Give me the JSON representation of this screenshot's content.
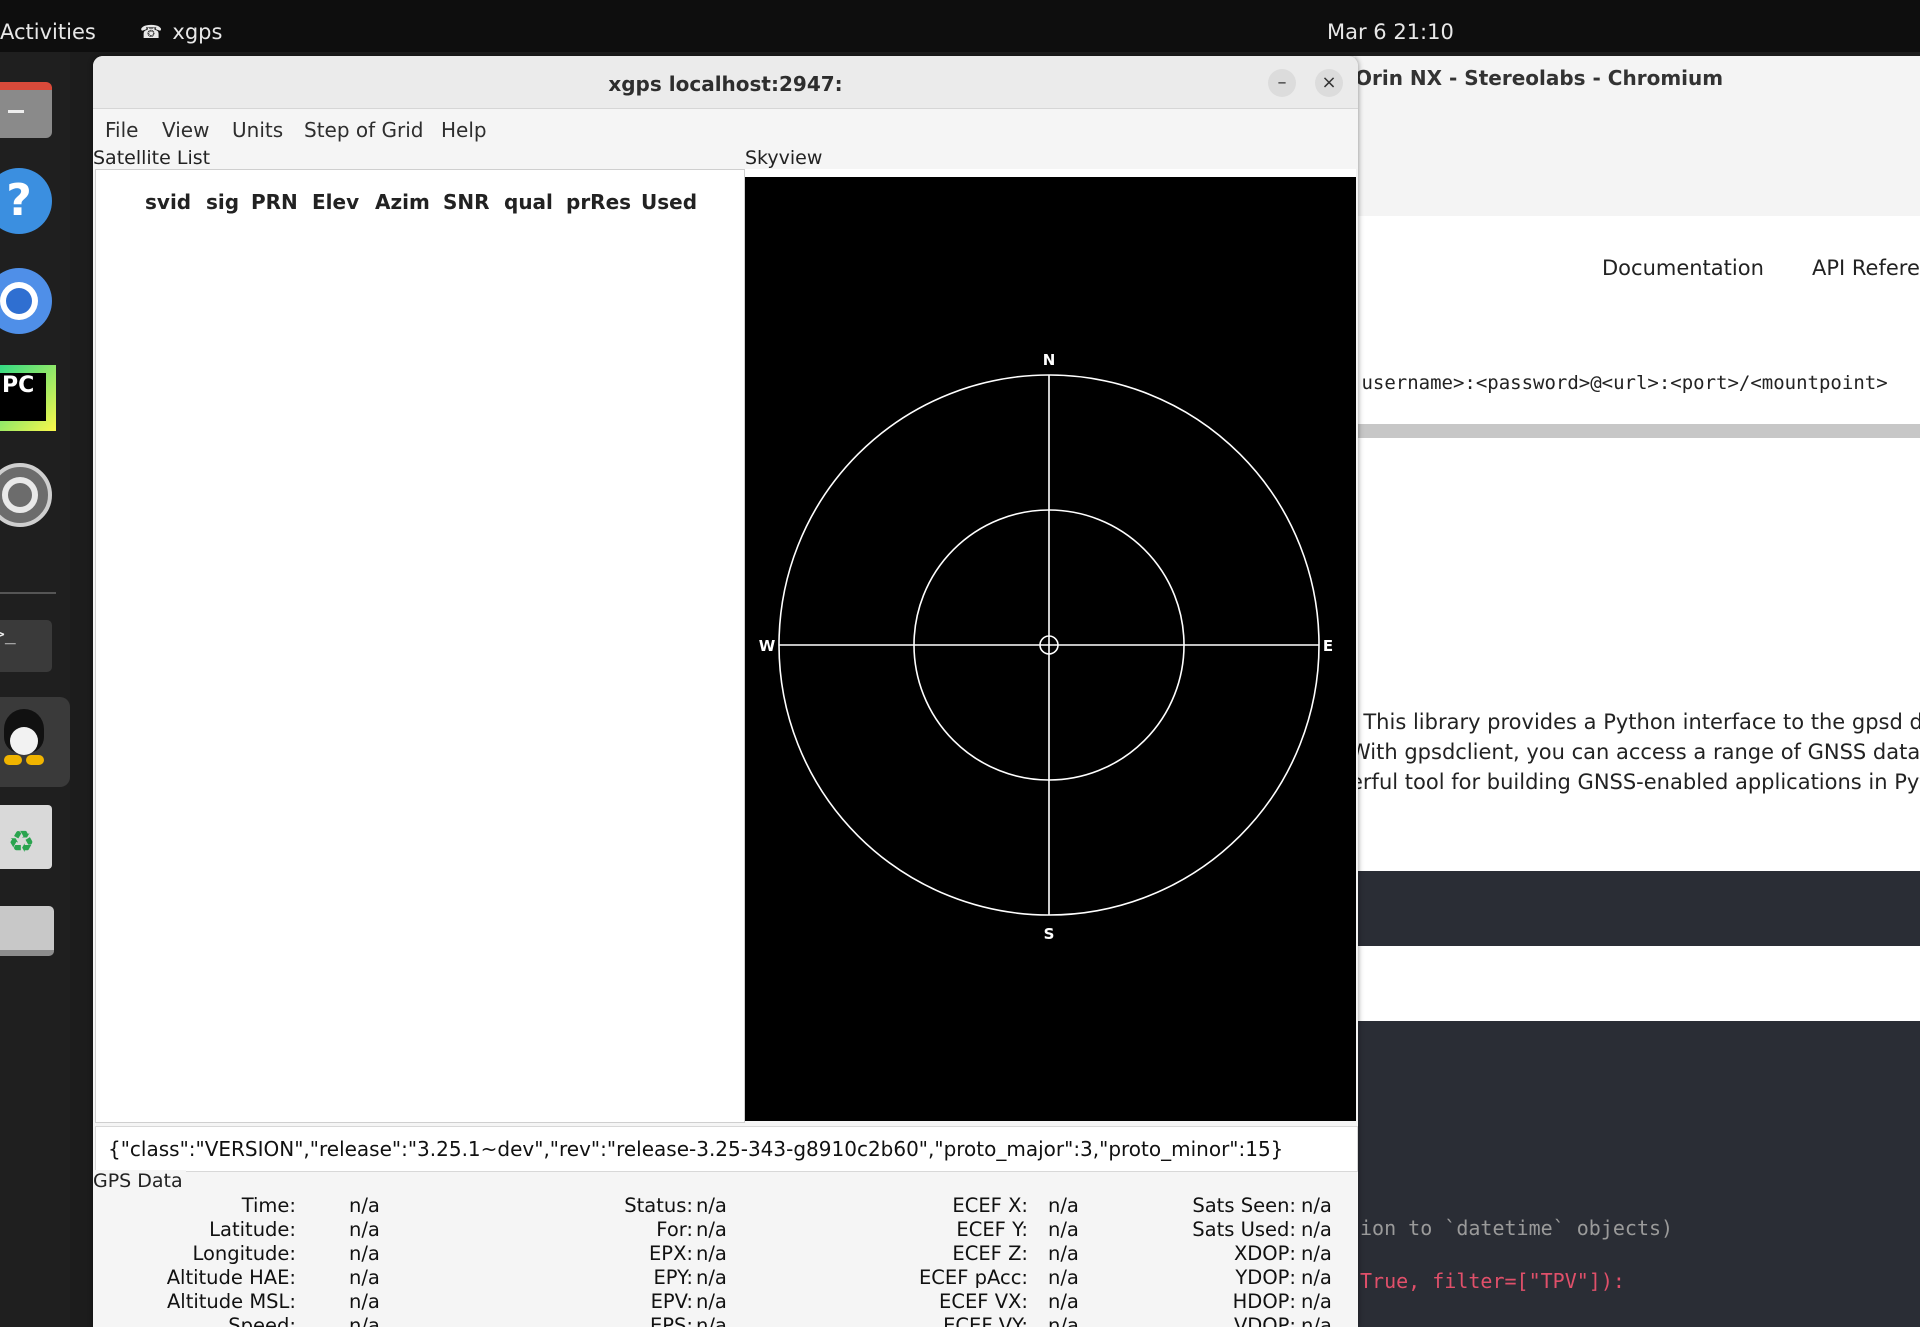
{
  "topbar": {
    "activities": "Activities",
    "app_name": "xgps",
    "clock": "Mar 6  21:10"
  },
  "dock": {
    "items": [
      {
        "name": "files-icon"
      },
      {
        "name": "help-icon"
      },
      {
        "name": "chromium-icon"
      },
      {
        "name": "pycharm-icon"
      },
      {
        "name": "settings-icon"
      },
      {
        "name": "terminal-icon"
      },
      {
        "name": "linux-tux-icon"
      },
      {
        "name": "trash-icon"
      },
      {
        "name": "drive-icon"
      }
    ],
    "pycharm_label": "PC",
    "terminal_label": ">_"
  },
  "browser": {
    "title": "Orin NX - Stereolabs - Chromium",
    "nav": [
      "Documentation",
      "API Referer"
    ],
    "code_url": ":username>:<password>@<url>:<port>/<mountpoint>",
    "paragraph": [
      ". This library provides a Python interface to the gpsd dae",
      "With gpsdclient, you can access a range of GNSS data,",
      "erful tool for building GNSS-enabled applications in Pyth"
    ],
    "code_lines": [
      "ion to `datetime` objects)",
      "True, filter=[\"TPV\"]):"
    ]
  },
  "window": {
    "title": "xgps localhost:2947:",
    "minimize": "–",
    "close": "×",
    "menu": [
      "File",
      "View",
      "Units",
      "Step of Grid",
      "Help"
    ]
  },
  "satellite_list": {
    "label": "Satellite List",
    "columns": [
      "svid",
      "sig",
      "PRN",
      "Elev",
      "Azim",
      "SNR",
      "qual",
      "prRes",
      "Used"
    ]
  },
  "skyview": {
    "label": "Skyview",
    "directions": {
      "n": "N",
      "s": "S",
      "e": "E",
      "w": "W"
    }
  },
  "status_line": "{\"class\":\"VERSION\",\"release\":\"3.25.1~dev\",\"rev\":\"release-3.25-343-g8910c2b60\",\"proto_major\":3,\"proto_minor\":15}",
  "gps_data": {
    "label": "GPS Data",
    "col1": [
      {
        "label": "Time:",
        "value": "n/a"
      },
      {
        "label": "Latitude:",
        "value": "n/a"
      },
      {
        "label": "Longitude:",
        "value": "n/a"
      },
      {
        "label": "Altitude HAE:",
        "value": "n/a"
      },
      {
        "label": "Altitude MSL:",
        "value": "n/a"
      },
      {
        "label": "Speed:",
        "value": "n/a"
      }
    ],
    "col2": [
      {
        "label": "Status:",
        "value": "n/a"
      },
      {
        "label": "For:",
        "value": "n/a"
      },
      {
        "label": "EPX:",
        "value": "n/a"
      },
      {
        "label": "EPY:",
        "value": "n/a"
      },
      {
        "label": "EPV:",
        "value": "n/a"
      },
      {
        "label": "EPS:",
        "value": "n/a"
      }
    ],
    "col3": [
      {
        "label": "ECEF X:",
        "value": "n/a"
      },
      {
        "label": "ECEF Y:",
        "value": "n/a"
      },
      {
        "label": "ECEF Z:",
        "value": "n/a"
      },
      {
        "label": "ECEF pAcc:",
        "value": "n/a"
      },
      {
        "label": "ECEF VX:",
        "value": "n/a"
      },
      {
        "label": "ECEF VY:",
        "value": "n/a"
      }
    ],
    "col4": [
      {
        "label": "Sats Seen:",
        "value": "n/a"
      },
      {
        "label": "Sats Used:",
        "value": "n/a"
      },
      {
        "label": "XDOP:",
        "value": "n/a"
      },
      {
        "label": "YDOP:",
        "value": "n/a"
      },
      {
        "label": "HDOP:",
        "value": "n/a"
      },
      {
        "label": "VDOP:",
        "value": "n/a"
      }
    ]
  }
}
